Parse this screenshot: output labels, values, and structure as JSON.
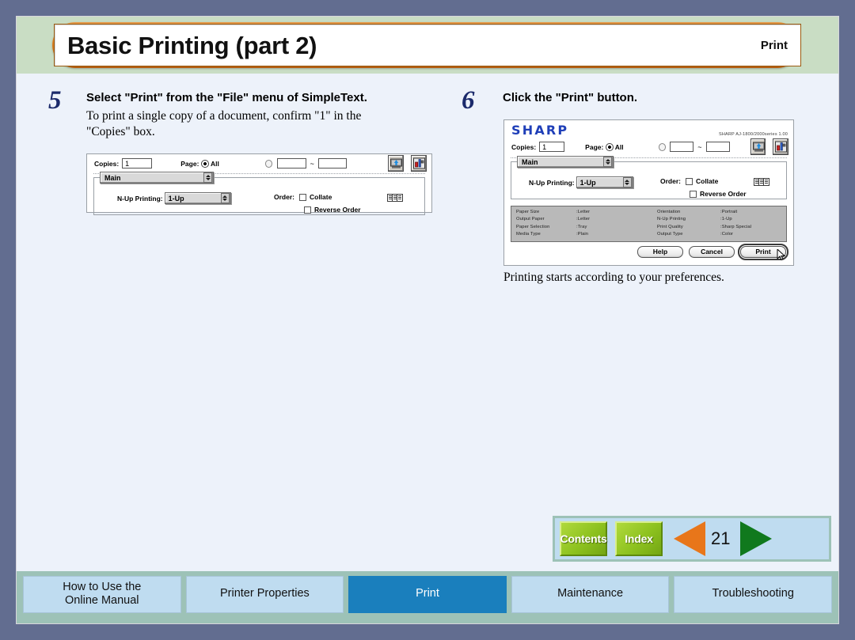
{
  "header": {
    "title": "Basic Printing (part 2)",
    "section": "Print"
  },
  "steps": [
    {
      "number": "5",
      "heading": "Select \"Print\" from the \"File\" menu of SimpleText.",
      "body_line1": "To print a single copy of a document, confirm \"1\" in the",
      "body_line2": "\"Copies\" box."
    },
    {
      "number": "6",
      "heading": "Click the \"Print\" button.",
      "after": "Printing starts according to your preferences."
    }
  ],
  "print_dialog": {
    "brand": "SHARP",
    "version": "SHARP AJ-1800/2000series 1.00",
    "copies_label": "Copies:",
    "copies_value": "1",
    "page_label": "Page:",
    "page_all_label": "All",
    "range_from": "",
    "range_to": "",
    "range_separator": "~",
    "panel_tab": "Main",
    "nup_label": "N-Up Printing:",
    "nup_value": "1-Up",
    "order_label": "Order:",
    "collate_label": "Collate",
    "reverse_order_label": "Reverse Order",
    "summary": {
      "left_keys": [
        "Paper Size",
        "Output Paper",
        "Paper Selection",
        "Media Type"
      ],
      "left_values": [
        ":Letter",
        ":Letter",
        ":Tray",
        ":Plain"
      ],
      "right_keys": [
        "Orientation",
        "N-Up Printing",
        "Print Quality",
        "Output Type"
      ],
      "right_values": [
        ":Portrait",
        ":1-Up",
        ":Sharp Special",
        ":Color"
      ]
    },
    "buttons": {
      "help": "Help",
      "cancel": "Cancel",
      "print": "Print"
    },
    "icons": {
      "save_to_file": "printer-upload-icon",
      "utility": "utility-tools-icon",
      "preview": "page-thumbnails-icon"
    }
  },
  "nav": {
    "contents": "Contents",
    "index": "Index",
    "prev_icon": "previous-page-arrow-icon",
    "next_icon": "next-page-arrow-icon",
    "page_number": "21"
  },
  "tabs": [
    {
      "label_line1": "How to Use the",
      "label_line2": "Online Manual",
      "active": false
    },
    {
      "label_line1": "Printer Properties",
      "label_line2": "",
      "active": false
    },
    {
      "label_line1": "Print",
      "label_line2": "",
      "active": true
    },
    {
      "label_line1": "Maintenance",
      "label_line2": "",
      "active": false
    },
    {
      "label_line1": "Troubleshooting",
      "label_line2": "",
      "active": false
    }
  ],
  "colors": {
    "frame": "#626d90",
    "header_band": "#c9ddc4",
    "header_pill": "#d1761b",
    "page_bg": "#edf2fa",
    "tab_bg": "#bfdcf0",
    "tab_active": "#1a7fbd",
    "tabbar_bg": "#9dc2b7",
    "nav_green": "#8dc21f",
    "arrow_prev": "#e8761a",
    "arrow_next": "#10791d",
    "step_number": "#1b2a6b",
    "sharp_blue": "#1f3fb8"
  }
}
